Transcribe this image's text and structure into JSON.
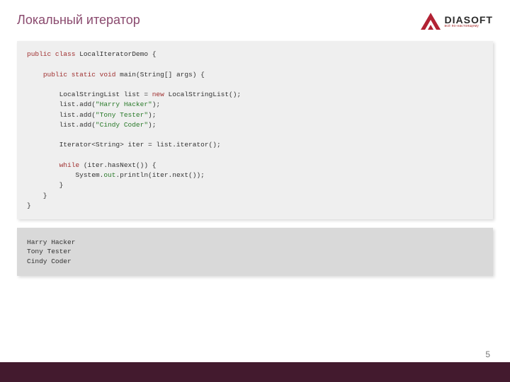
{
  "title": "Локальный итератор",
  "logo": {
    "name": "DIASOFT",
    "tagline": "всё по-настоящему"
  },
  "code": {
    "tokens": [
      {
        "t": "kw",
        "v": "public class"
      },
      {
        "t": "",
        "v": " LocalIteratorDemo {\n\n    "
      },
      {
        "t": "kw",
        "v": "public static void"
      },
      {
        "t": "",
        "v": " main(String[] args) {\n\n        LocalStringList list = "
      },
      {
        "t": "kw",
        "v": "new"
      },
      {
        "t": "",
        "v": " LocalStringList();\n        list.add("
      },
      {
        "t": "str",
        "v": "\"Harry Hacker\""
      },
      {
        "t": "",
        "v": ");\n        list.add("
      },
      {
        "t": "str",
        "v": "\"Tony Tester\""
      },
      {
        "t": "",
        "v": ");\n        list.add("
      },
      {
        "t": "str",
        "v": "\"Cindy Coder\""
      },
      {
        "t": "",
        "v": ");\n\n        Iterator<String> iter = list.iterator();\n\n        "
      },
      {
        "t": "kw",
        "v": "while"
      },
      {
        "t": "",
        "v": " (iter.hasNext()) {\n            System."
      },
      {
        "t": "out",
        "v": "out"
      },
      {
        "t": "",
        "v": ".println(iter.next());\n        }\n    }\n}"
      }
    ]
  },
  "output": "Harry Hacker\nTony Tester\nCindy Coder",
  "page": "5"
}
